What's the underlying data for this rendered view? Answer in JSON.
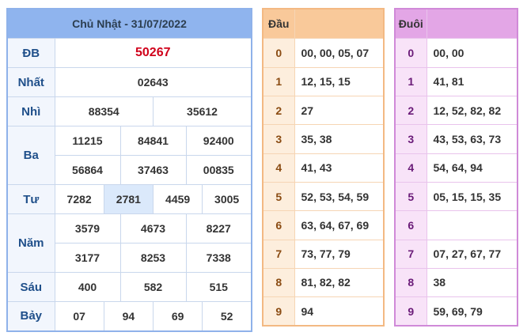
{
  "results": {
    "title": "Chủ Nhật - 31/07/2022",
    "rows": [
      {
        "label": "ĐB",
        "values": [
          "50267"
        ]
      },
      {
        "label": "Nhất",
        "values": [
          "02643"
        ]
      },
      {
        "label": "Nhì",
        "values": [
          "88354",
          "35612"
        ]
      },
      {
        "label": "Ba",
        "values": [
          "11215",
          "84841",
          "92400",
          "56864",
          "37463",
          "00835"
        ]
      },
      {
        "label": "Tư",
        "values": [
          "7282",
          "2781",
          "4459",
          "3005"
        ]
      },
      {
        "label": "Năm",
        "values": [
          "3579",
          "4673",
          "8227",
          "3177",
          "8253",
          "7338"
        ]
      },
      {
        "label": "Sáu",
        "values": [
          "400",
          "582",
          "515"
        ]
      },
      {
        "label": "Bảy",
        "values": [
          "07",
          "94",
          "69",
          "52"
        ]
      }
    ]
  },
  "dau": {
    "header": "Đầu",
    "rows": [
      {
        "key": "0",
        "values": "00, 00, 05, 07"
      },
      {
        "key": "1",
        "values": "12, 15, 15"
      },
      {
        "key": "2",
        "values": "27"
      },
      {
        "key": "3",
        "values": "35, 38"
      },
      {
        "key": "4",
        "values": "41, 43"
      },
      {
        "key": "5",
        "values": "52, 53, 54, 59"
      },
      {
        "key": "6",
        "values": "63, 64, 67, 69"
      },
      {
        "key": "7",
        "values": "73, 77, 79"
      },
      {
        "key": "8",
        "values": "81, 82, 82"
      },
      {
        "key": "9",
        "values": "94"
      }
    ]
  },
  "duoi": {
    "header": "Đuôi",
    "rows": [
      {
        "key": "0",
        "values": "00, 00"
      },
      {
        "key": "1",
        "values": "41, 81"
      },
      {
        "key": "2",
        "values": "12, 52, 82, 82"
      },
      {
        "key": "3",
        "values": "43, 53, 63, 73"
      },
      {
        "key": "4",
        "values": "54, 64, 94"
      },
      {
        "key": "5",
        "values": "05, 15, 15, 35"
      },
      {
        "key": "6",
        "values": ""
      },
      {
        "key": "7",
        "values": "07, 27, 67, 77"
      },
      {
        "key": "8",
        "values": "38"
      },
      {
        "key": "9",
        "values": "59, 69, 79"
      }
    ]
  },
  "colors": {
    "special": "#d0021b",
    "results_header": "#8fb4ee",
    "dau_header": "#f9c99a",
    "duoi_header": "#e3a6e6"
  }
}
